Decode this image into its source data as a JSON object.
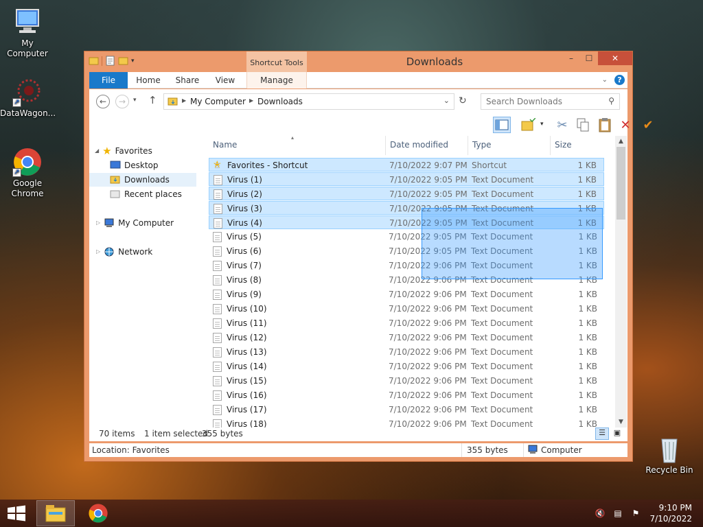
{
  "desktop": {
    "icons": [
      {
        "label": "My Computer"
      },
      {
        "label": "DataWagon..."
      },
      {
        "label": "Google Chrome"
      },
      {
        "label": "Recycle Bin"
      }
    ]
  },
  "window": {
    "title": "Downloads",
    "context_tab_group": "Shortcut Tools",
    "tabs": [
      "File",
      "Home",
      "Share",
      "View",
      "Manage"
    ],
    "controls": {
      "minimize": "–",
      "maximize": "☐",
      "close": "✕"
    }
  },
  "address": {
    "crumbs": [
      "My Computer",
      "Downloads"
    ],
    "search_placeholder": "Search Downloads"
  },
  "nav_pane": {
    "favorites": "Favorites",
    "desktop": "Desktop",
    "downloads": "Downloads",
    "recent": "Recent places",
    "computer": "My Computer",
    "network": "Network"
  },
  "columns": {
    "name": "Name",
    "date": "Date modified",
    "type": "Type",
    "size": "Size"
  },
  "files": [
    {
      "name": "Favorites - Shortcut",
      "date": "7/10/2022 9:07 PM",
      "type": "Shortcut",
      "size": "1 KB",
      "selected": true
    },
    {
      "name": "Virus (1)",
      "date": "7/10/2022 9:05 PM",
      "type": "Text Document",
      "size": "1 KB",
      "selected": true
    },
    {
      "name": "Virus (2)",
      "date": "7/10/2022 9:05 PM",
      "type": "Text Document",
      "size": "1 KB",
      "selected": true
    },
    {
      "name": "Virus (3)",
      "date": "7/10/2022 9:05 PM",
      "type": "Text Document",
      "size": "1 KB",
      "selected": true
    },
    {
      "name": "Virus (4)",
      "date": "7/10/2022 9:05 PM",
      "type": "Text Document",
      "size": "1 KB",
      "selected": true
    },
    {
      "name": "Virus (5)",
      "date": "7/10/2022 9:05 PM",
      "type": "Text Document",
      "size": "1 KB",
      "selected": false
    },
    {
      "name": "Virus (6)",
      "date": "7/10/2022 9:05 PM",
      "type": "Text Document",
      "size": "1 KB",
      "selected": false
    },
    {
      "name": "Virus (7)",
      "date": "7/10/2022 9:06 PM",
      "type": "Text Document",
      "size": "1 KB",
      "selected": false
    },
    {
      "name": "Virus (8)",
      "date": "7/10/2022 9:06 PM",
      "type": "Text Document",
      "size": "1 KB",
      "selected": false
    },
    {
      "name": "Virus (9)",
      "date": "7/10/2022 9:06 PM",
      "type": "Text Document",
      "size": "1 KB",
      "selected": false
    },
    {
      "name": "Virus (10)",
      "date": "7/10/2022 9:06 PM",
      "type": "Text Document",
      "size": "1 KB",
      "selected": false
    },
    {
      "name": "Virus (11)",
      "date": "7/10/2022 9:06 PM",
      "type": "Text Document",
      "size": "1 KB",
      "selected": false
    },
    {
      "name": "Virus (12)",
      "date": "7/10/2022 9:06 PM",
      "type": "Text Document",
      "size": "1 KB",
      "selected": false
    },
    {
      "name": "Virus (13)",
      "date": "7/10/2022 9:06 PM",
      "type": "Text Document",
      "size": "1 KB",
      "selected": false
    },
    {
      "name": "Virus (14)",
      "date": "7/10/2022 9:06 PM",
      "type": "Text Document",
      "size": "1 KB",
      "selected": false
    },
    {
      "name": "Virus (15)",
      "date": "7/10/2022 9:06 PM",
      "type": "Text Document",
      "size": "1 KB",
      "selected": false
    },
    {
      "name": "Virus (16)",
      "date": "7/10/2022 9:06 PM",
      "type": "Text Document",
      "size": "1 KB",
      "selected": false
    },
    {
      "name": "Virus (17)",
      "date": "7/10/2022 9:06 PM",
      "type": "Text Document",
      "size": "1 KB",
      "selected": false
    },
    {
      "name": "Virus (18)",
      "date": "7/10/2022 9:06 PM",
      "type": "Text Document",
      "size": "1 KB",
      "selected": false
    }
  ],
  "status": {
    "count": "70 items",
    "selection": "1 item selected",
    "selection_size": "355 bytes"
  },
  "details_bar": {
    "location": "Location: Favorites",
    "size": "355 bytes",
    "zone": "Computer"
  },
  "taskbar": {
    "time": "9:10 PM",
    "date": "7/10/2022"
  },
  "colors": {
    "accent": "#1979ca",
    "window_frame": "#ec9a6c",
    "selection": "#cde8ff",
    "close": "#c7503a"
  }
}
